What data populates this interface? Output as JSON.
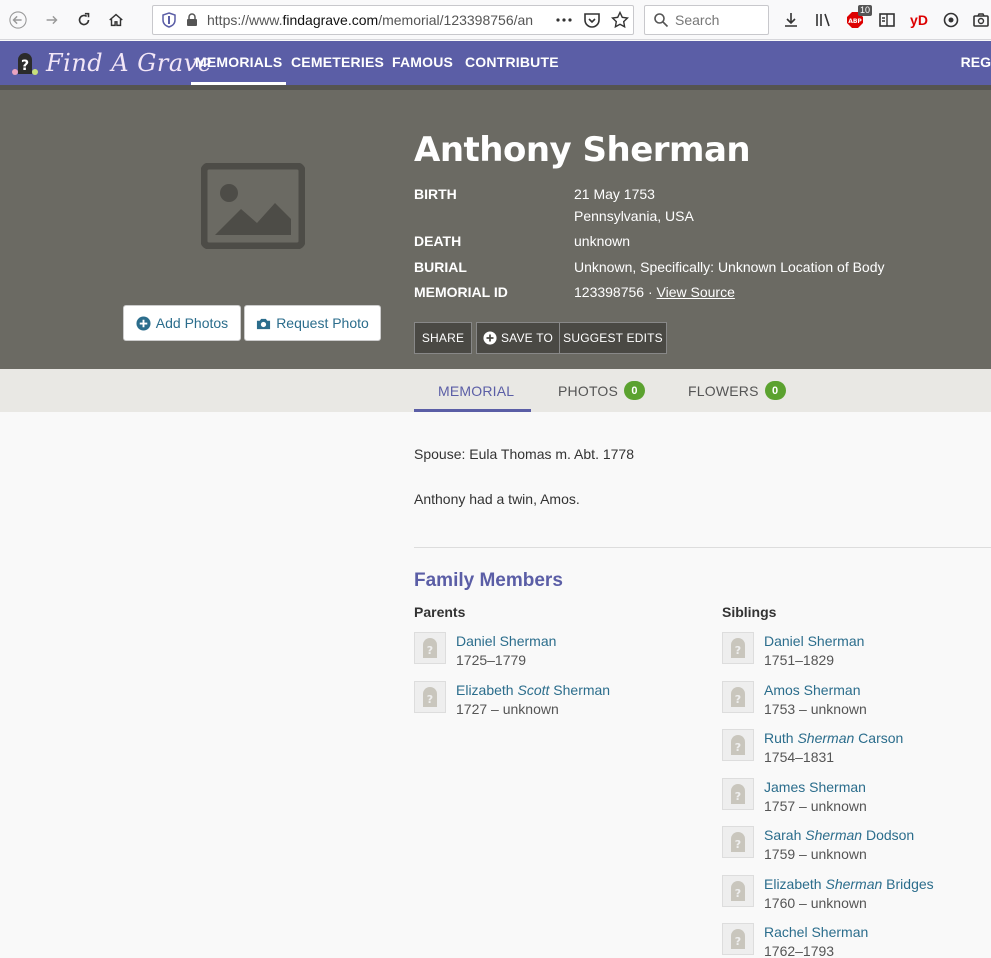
{
  "browser": {
    "url_prefix": "https://www.",
    "url_domain": "findagrave.com",
    "url_suffix": "/memorial/123398756/an",
    "search_placeholder": "Search",
    "abp_count": "10",
    "abp_label": "ABP",
    "yd_label": "yD"
  },
  "nav": {
    "logo_text": "Find A Grave",
    "items": [
      "MEMORIALS",
      "CEMETERIES",
      "FAMOUS",
      "CONTRIBUTE"
    ],
    "right_label": "REG"
  },
  "hero": {
    "name": "Anthony Sherman",
    "add_photos": "Add Photos",
    "request_photo": "Request Photo",
    "birth_label": "BIRTH",
    "birth_date": "21 May 1753",
    "birth_place": "Pennsylvania, USA",
    "death_label": "DEATH",
    "death_value": "unknown",
    "burial_label": "BURIAL",
    "burial_value": "Unknown, Specifically: Unknown Location of Body",
    "memorial_id_label": "MEMORIAL ID",
    "memorial_id": "123398756 · ",
    "view_source": "View Source",
    "share": "SHARE",
    "save_to": "SAVE TO",
    "suggest_edits": "SUGGEST EDITS"
  },
  "tabs": {
    "memorial": "MEMORIAL",
    "photos": "PHOTOS",
    "photos_count": "0",
    "flowers": "FLOWERS",
    "flowers_count": "0"
  },
  "bio": {
    "line1": "Spouse: Eula Thomas m. Abt. 1778",
    "line2": "Anthony had a twin, Amos."
  },
  "family": {
    "title": "Family Members",
    "parents_title": "Parents",
    "siblings_title": "Siblings",
    "parents": [
      {
        "first": "Daniel Sherman",
        "maiden": "",
        "last": "",
        "dates": "1725–1779"
      },
      {
        "first": "Elizabeth ",
        "maiden": "Scott",
        "last": " Sherman",
        "dates": "1727 – unknown"
      }
    ],
    "siblings": [
      {
        "first": "Daniel Sherman",
        "maiden": "",
        "last": "",
        "dates": "1751–1829"
      },
      {
        "first": "Amos Sherman",
        "maiden": "",
        "last": "",
        "dates": "1753 – unknown"
      },
      {
        "first": "Ruth ",
        "maiden": "Sherman",
        "last": " Carson",
        "dates": "1754–1831"
      },
      {
        "first": "James Sherman",
        "maiden": "",
        "last": "",
        "dates": "1757 – unknown"
      },
      {
        "first": "Sarah ",
        "maiden": "Sherman",
        "last": " Dodson",
        "dates": "1759 – unknown"
      },
      {
        "first": "Elizabeth ",
        "maiden": "Sherman",
        "last": " Bridges",
        "dates": "1760 – unknown"
      },
      {
        "first": "Rachel Sherman",
        "maiden": "",
        "last": "",
        "dates": "1762–1793"
      }
    ]
  }
}
